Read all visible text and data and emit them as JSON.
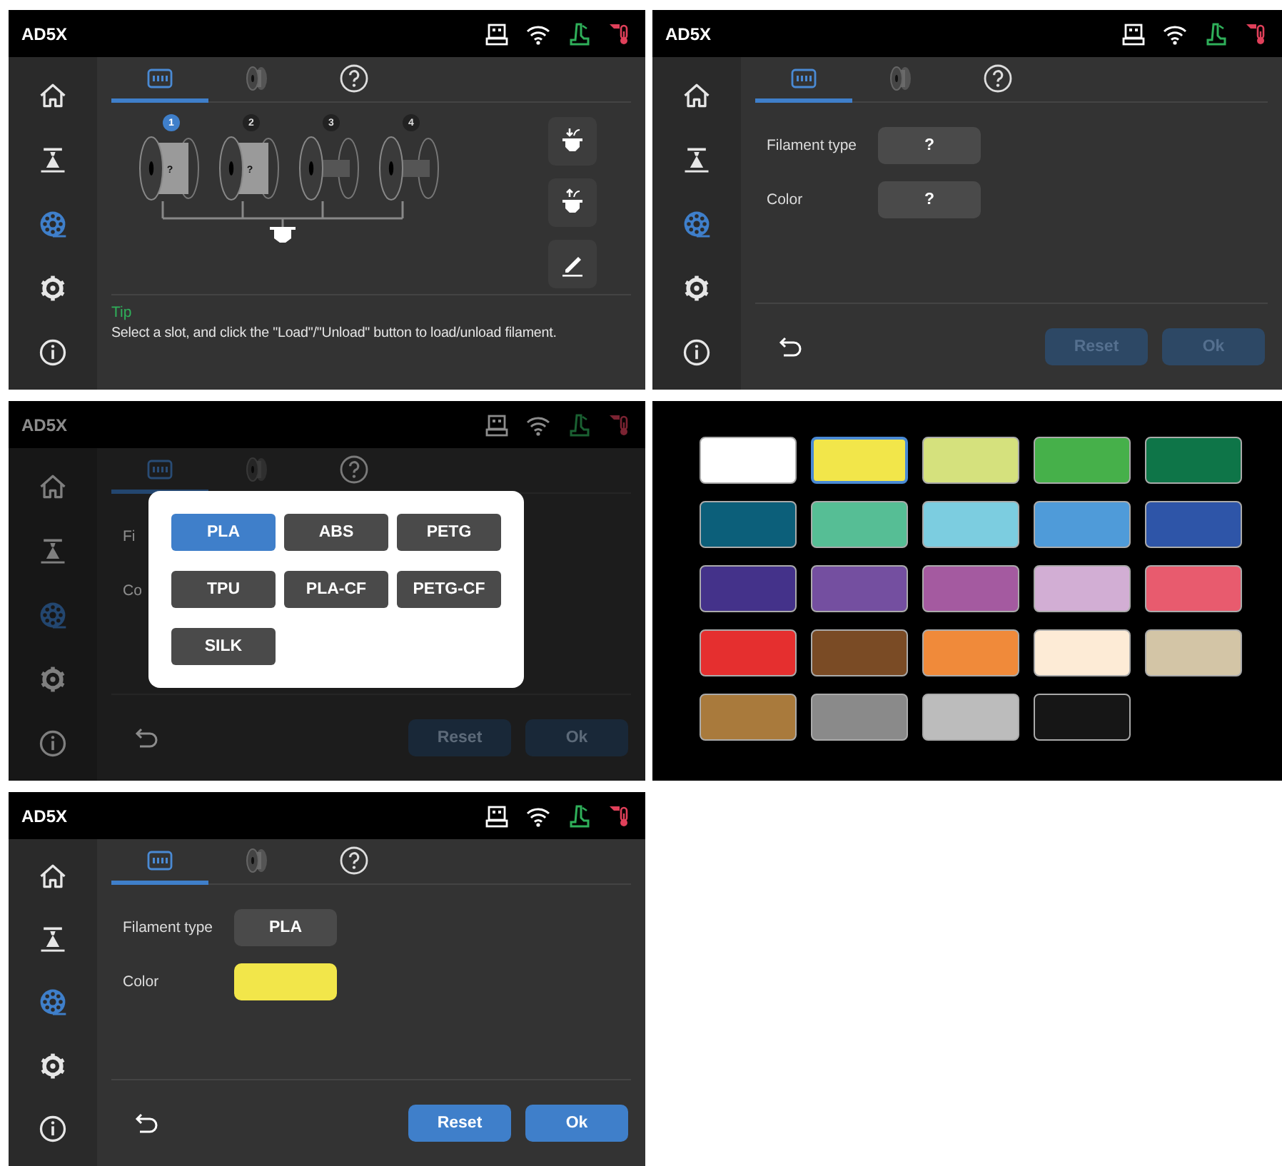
{
  "screens": [
    {
      "kind": "slots",
      "title": "AD5X",
      "dimmed": false,
      "nav": [
        {
          "selected": false
        },
        {
          "selected": false
        },
        {
          "selected": true
        },
        {
          "selected": false
        },
        {
          "selected": false
        }
      ],
      "tabs": [
        {
          "selected": true
        },
        {
          "selected": false
        },
        {
          "selected": false
        }
      ],
      "slots": [
        {
          "number": "1",
          "selected": true,
          "loaded": true,
          "label": "?"
        },
        {
          "number": "2",
          "selected": false,
          "loaded": true,
          "label": "?"
        },
        {
          "number": "3",
          "selected": false,
          "loaded": false
        },
        {
          "number": "4",
          "selected": false,
          "loaded": false
        }
      ],
      "tip_title": "Tip",
      "tip": "Select a slot, and click the \"Load\"/\"Unload\" button to load/unload filament."
    },
    {
      "kind": "form",
      "title": "AD5X",
      "dimmed": false,
      "nav": [
        {
          "selected": false
        },
        {
          "selected": false
        },
        {
          "selected": true
        },
        {
          "selected": false
        },
        {
          "selected": false
        }
      ],
      "tabs": [
        {
          "selected": true
        },
        {
          "selected": false
        },
        {
          "selected": false
        }
      ],
      "fields": [
        {
          "label": "Filament type",
          "value": "?"
        },
        {
          "label": "Color",
          "value": "?"
        }
      ],
      "buttons": [
        {
          "label": "Reset",
          "disabled": true
        },
        {
          "label": "Ok",
          "disabled": true
        }
      ]
    },
    {
      "kind": "form",
      "title": "AD5X",
      "dimmed": true,
      "nav": [
        {
          "selected": false
        },
        {
          "selected": false
        },
        {
          "selected": true
        },
        {
          "selected": false
        },
        {
          "selected": false
        }
      ],
      "tabs": [
        {
          "selected": true
        },
        {
          "selected": false
        },
        {
          "selected": false
        }
      ],
      "fields": [
        {
          "label": "Fi"
        },
        {
          "label": "Co"
        }
      ],
      "buttons": [
        {
          "label": "Reset",
          "disabled": true
        },
        {
          "label": "Ok",
          "disabled": true
        }
      ],
      "popup": {
        "options": [
          {
            "label": "PLA",
            "selected": true
          },
          {
            "label": "ABS",
            "selected": false
          },
          {
            "label": "PETG",
            "selected": false
          },
          {
            "label": "TPU",
            "selected": false
          },
          {
            "label": "PLA-CF",
            "selected": false
          },
          {
            "label": "PETG-CF",
            "selected": false
          },
          {
            "label": "SILK",
            "selected": false
          }
        ]
      }
    },
    {
      "kind": "palette",
      "swatches": [
        {
          "color": "#ffffff",
          "selected": false
        },
        {
          "color": "#f2e64a",
          "selected": true
        },
        {
          "color": "#d5e17d",
          "selected": false
        },
        {
          "color": "#46b04a",
          "selected": false
        },
        {
          "color": "#0e7548",
          "selected": false
        },
        {
          "color": "#0c5f7a",
          "selected": false
        },
        {
          "color": "#56be95",
          "selected": false
        },
        {
          "color": "#7ccde0",
          "selected": false
        },
        {
          "color": "#4f9bd9",
          "selected": false
        },
        {
          "color": "#2e55a8",
          "selected": false
        },
        {
          "color": "#44328a",
          "selected": false
        },
        {
          "color": "#744fa0",
          "selected": false
        },
        {
          "color": "#a45aa0",
          "selected": false
        },
        {
          "color": "#d2aed4",
          "selected": false
        },
        {
          "color": "#e85b6e",
          "selected": false
        },
        {
          "color": "#e52f2f",
          "selected": false
        },
        {
          "color": "#7a4b25",
          "selected": false
        },
        {
          "color": "#f08a3a",
          "selected": false
        },
        {
          "color": "#fdebd6",
          "selected": false
        },
        {
          "color": "#d3c5a6",
          "selected": false
        },
        {
          "color": "#a97a3c",
          "selected": false
        },
        {
          "color": "#8a8a8a",
          "selected": false
        },
        {
          "color": "#bcbcbc",
          "selected": false
        },
        {
          "color": "#161616",
          "selected": false
        }
      ]
    },
    {
      "kind": "form",
      "title": "AD5X",
      "dimmed": false,
      "nav": [
        {
          "selected": false
        },
        {
          "selected": false
        },
        {
          "selected": true
        },
        {
          "selected": false
        },
        {
          "selected": false
        }
      ],
      "tabs": [
        {
          "selected": true
        },
        {
          "selected": false
        },
        {
          "selected": false
        }
      ],
      "fields": [
        {
          "label": "Filament type",
          "value": "PLA"
        },
        {
          "label": "Color",
          "color": "#f2e64a"
        }
      ],
      "buttons": [
        {
          "label": "Reset",
          "disabled": false
        },
        {
          "label": "Ok",
          "disabled": false
        }
      ]
    }
  ]
}
